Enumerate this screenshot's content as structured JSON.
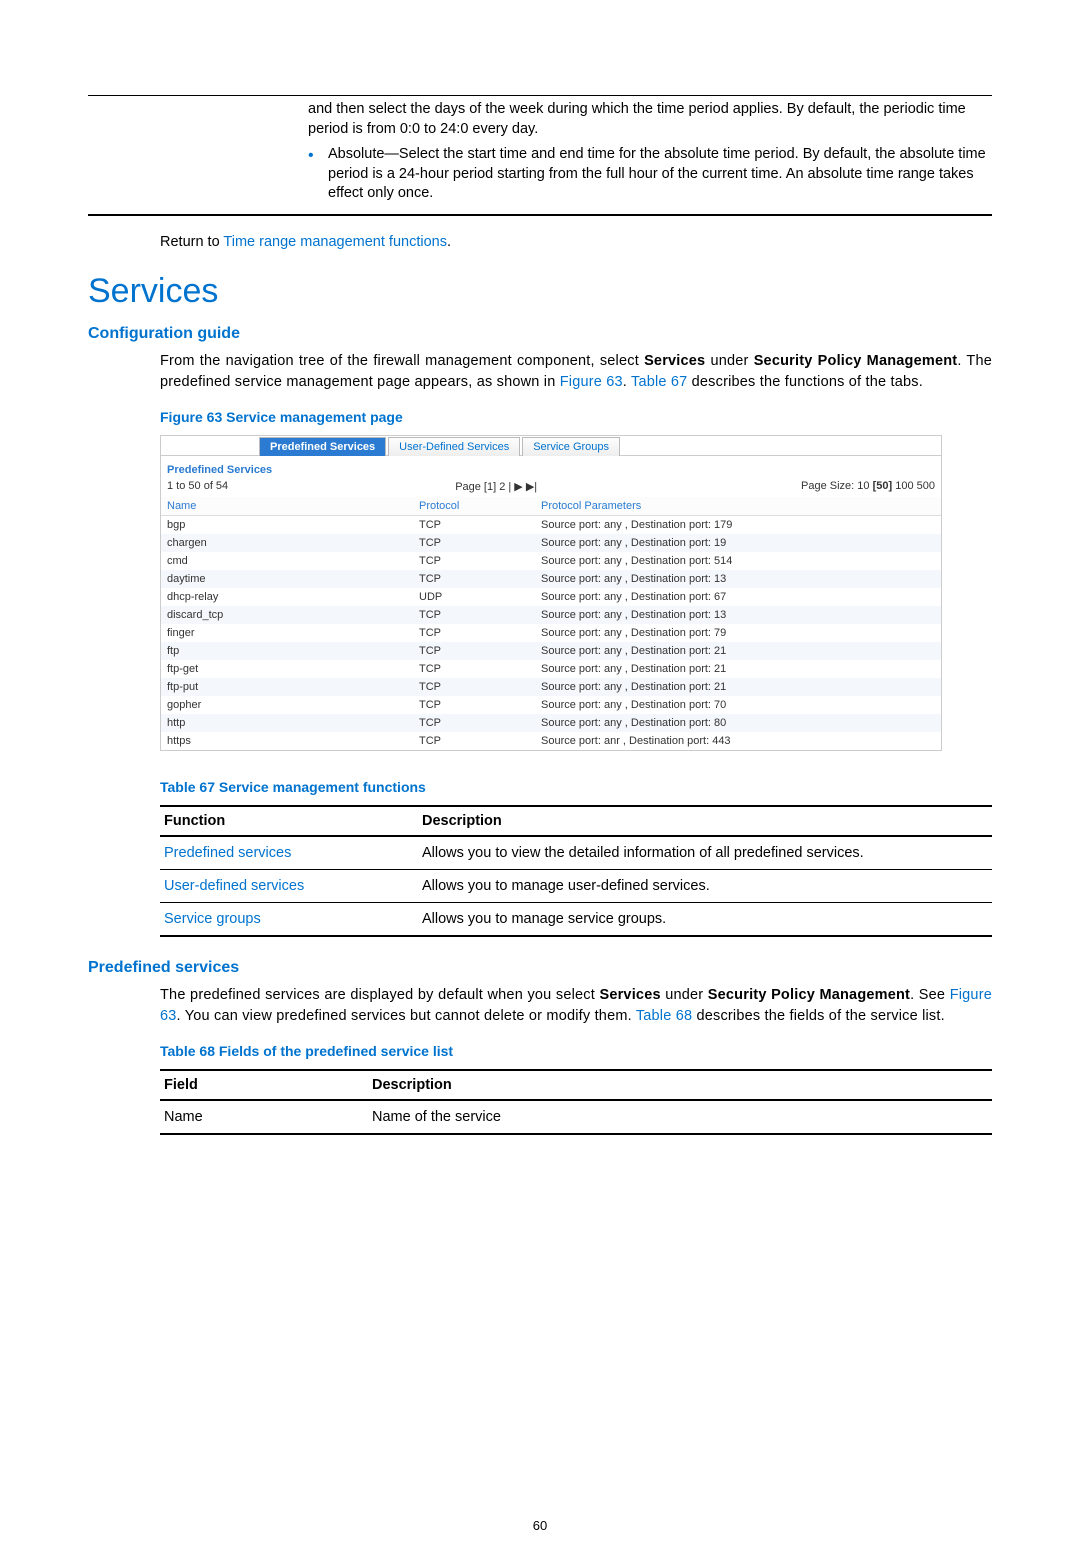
{
  "top_note": {
    "line1": "and then select the days of the week during which the time period applies. By default, the periodic time period is from 0:0 to 24:0 every day.",
    "bullet": "Absolute—Select the start time and end time for the absolute time period. By default, the absolute time period is a 24-hour period starting from the full hour of the current time. An absolute time range takes effect only once."
  },
  "return_line": {
    "prefix": "Return to ",
    "link": "Time range management functions",
    "suffix": "."
  },
  "heading_services": "Services",
  "heading_config": "Configuration guide",
  "config_para": {
    "p1a": "From the navigation tree of the firewall management component, select ",
    "p1b": "Services",
    "p1c": " under ",
    "p1d": "Security Policy Management",
    "p1e": ". The predefined service management page appears, as shown in ",
    "p1f": "Figure 63",
    "p1g": ". ",
    "p1h": "Table 67",
    "p1i": " describes the functions of the tabs."
  },
  "figure63_caption": "Figure 63 Service management page",
  "figure63": {
    "tabs": [
      "Predefined Services",
      "User-Defined Services",
      "Service Groups"
    ],
    "section_title": "Predefined Services",
    "count_text": "1 to 50 of 54",
    "page_text": "Page [1] 2 | ▶  ▶|",
    "page_size_prefix": "Page Size: ",
    "page_size_opts": [
      "10",
      "[50]",
      "100",
      "500"
    ],
    "columns": [
      "Name",
      "Protocol",
      "Protocol Parameters"
    ],
    "rows": [
      {
        "name": "bgp",
        "proto": "TCP",
        "params": "Source port: any , Destination port: 179"
      },
      {
        "name": "chargen",
        "proto": "TCP",
        "params": "Source port: any , Destination port: 19"
      },
      {
        "name": "cmd",
        "proto": "TCP",
        "params": "Source port: any , Destination port: 514"
      },
      {
        "name": "daytime",
        "proto": "TCP",
        "params": "Source port: any , Destination port: 13"
      },
      {
        "name": "dhcp-relay",
        "proto": "UDP",
        "params": "Source port: any , Destination port: 67"
      },
      {
        "name": "discard_tcp",
        "proto": "TCP",
        "params": "Source port: any , Destination port: 13"
      },
      {
        "name": "finger",
        "proto": "TCP",
        "params": "Source port: any , Destination port: 79"
      },
      {
        "name": "ftp",
        "proto": "TCP",
        "params": "Source port: any , Destination port: 21"
      },
      {
        "name": "ftp-get",
        "proto": "TCP",
        "params": "Source port: any , Destination port: 21"
      },
      {
        "name": "ftp-put",
        "proto": "TCP",
        "params": "Source port: any , Destination port: 21"
      },
      {
        "name": "gopher",
        "proto": "TCP",
        "params": "Source port: any , Destination port: 70"
      },
      {
        "name": "http",
        "proto": "TCP",
        "params": "Source port: any , Destination port: 80"
      },
      {
        "name": "https",
        "proto": "TCP",
        "params": "Source port: anr , Destination port: 443"
      }
    ]
  },
  "table67_caption": "Table 67 Service management functions",
  "table67": {
    "head": [
      "Function",
      "Description"
    ],
    "rows": [
      {
        "fn": "Predefined services",
        "desc": "Allows you to view the detailed information of all predefined services."
      },
      {
        "fn": "User-defined services",
        "desc": "Allows you to manage user-defined services."
      },
      {
        "fn": "Service groups",
        "desc": "Allows you to manage service groups."
      }
    ]
  },
  "heading_predef": "Predefined services",
  "predef_para": {
    "p1a": "The predefined services are displayed by default when you select ",
    "p1b": "Services",
    "p1c": " under ",
    "p1d": "Security Policy Management",
    "p1e": ". See ",
    "p1f": "Figure 63",
    "p1g": ". You can view predefined services but cannot delete or modify them. ",
    "p1h": "Table 68",
    "p1i": " describes the fields of the service list."
  },
  "table68_caption": "Table 68 Fields of the predefined service list",
  "table68": {
    "head": [
      "Field",
      "Description"
    ],
    "rows": [
      {
        "f": "Name",
        "d": "Name of the service"
      }
    ]
  },
  "page_number": "60"
}
